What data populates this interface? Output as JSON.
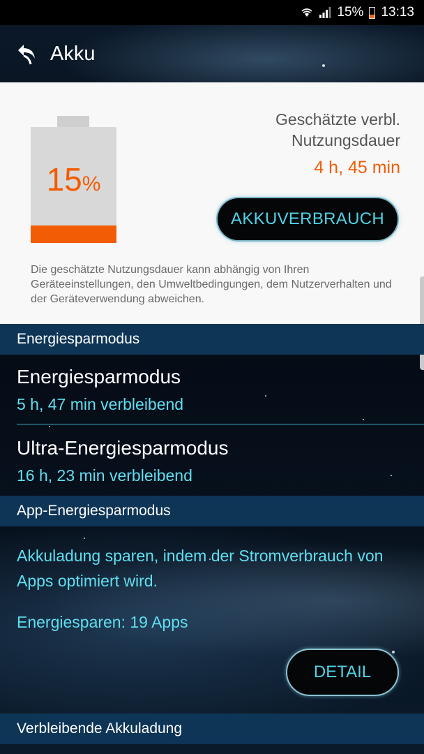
{
  "status_bar": {
    "battery_percent": "15%",
    "time": "13:13",
    "icons": [
      "wifi-icon",
      "signal-icon",
      "battery-icon"
    ]
  },
  "header": {
    "title": "Akku",
    "back_icon": "back-arrow-icon"
  },
  "battery_card": {
    "percent_number": "15",
    "percent_sign": "%",
    "level": 0.15,
    "estimate_label_line1": "Geschätzte verbl.",
    "estimate_label_line2": "Nutzungsdauer",
    "estimate_value": "4 h, 45 min",
    "usage_button": "AKKUVERBRAUCH",
    "disclaimer": "Die geschätzte Nutzungsdauer kann abhängig von Ihren Geräteeinstellungen, den Umweltbedingungen, dem Nutzerverhalten und der Geräteverwendung abweichen."
  },
  "power_saving": {
    "section_title": "Energiesparmodus",
    "items": [
      {
        "title": "Energiesparmodus",
        "subtitle": "5 h, 47 min verbleibend"
      },
      {
        "title": "Ultra-Energiesparmodus",
        "subtitle": "16 h, 23 min verbleibend"
      }
    ]
  },
  "app_power_saving": {
    "section_title": "App-Energiesparmodus",
    "description": "Akkuladung sparen, indem der Stromverbrauch von Apps optimiert wird.",
    "apps_count_text": "Energiesparen: 19 Apps",
    "detail_button": "DETAIL"
  },
  "remaining_charge": {
    "section_title": "Verbleibende Akkuladung"
  },
  "colors": {
    "accent_orange": "#f25c05",
    "accent_cyan": "#5fdff0",
    "section_header_bg": "#0e3556"
  }
}
